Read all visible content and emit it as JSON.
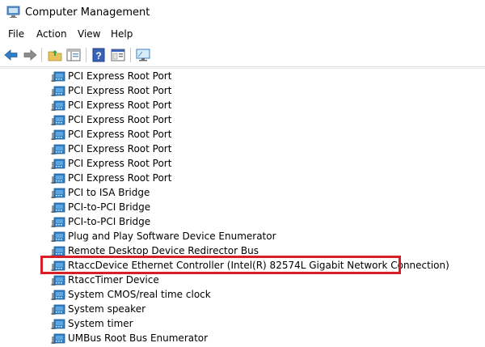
{
  "window": {
    "title": "Computer Management",
    "app_icon": "computer-management-icon"
  },
  "menu": [
    "File",
    "Action",
    "View",
    "Help"
  ],
  "toolbar": {
    "buttons": [
      "back-arrow-icon",
      "forward-arrow-icon",
      "up-folder-icon",
      "show-hide-console-tree-icon",
      "help-icon",
      "properties-icon",
      "monitor-icon"
    ]
  },
  "device_list": [
    "PCI Express Root Port",
    "PCI Express Root Port",
    "PCI Express Root Port",
    "PCI Express Root Port",
    "PCI Express Root Port",
    "PCI Express Root Port",
    "PCI Express Root Port",
    "PCI Express Root Port",
    "PCI to ISA Bridge",
    "PCI-to-PCI Bridge",
    "PCI-to-PCI Bridge",
    "Plug and Play Software Device Enumerator",
    "Remote Desktop Device Redirector Bus",
    "RtaccDevice Ethernet Controller (Intel(R) 82574L Gigabit Network Connection)",
    "RtaccTimer Device",
    "System CMOS/real time clock",
    "System speaker",
    "System timer",
    "UMBus Root Bus Enumerator"
  ],
  "highlighted_item": "RtaccDevice Ethernet Controller (Intel(R) 82574L Gigabit Network Connection)",
  "colors": {
    "highlight_border": "#d81f26",
    "device_icon_blue": "#2f7fc4"
  }
}
